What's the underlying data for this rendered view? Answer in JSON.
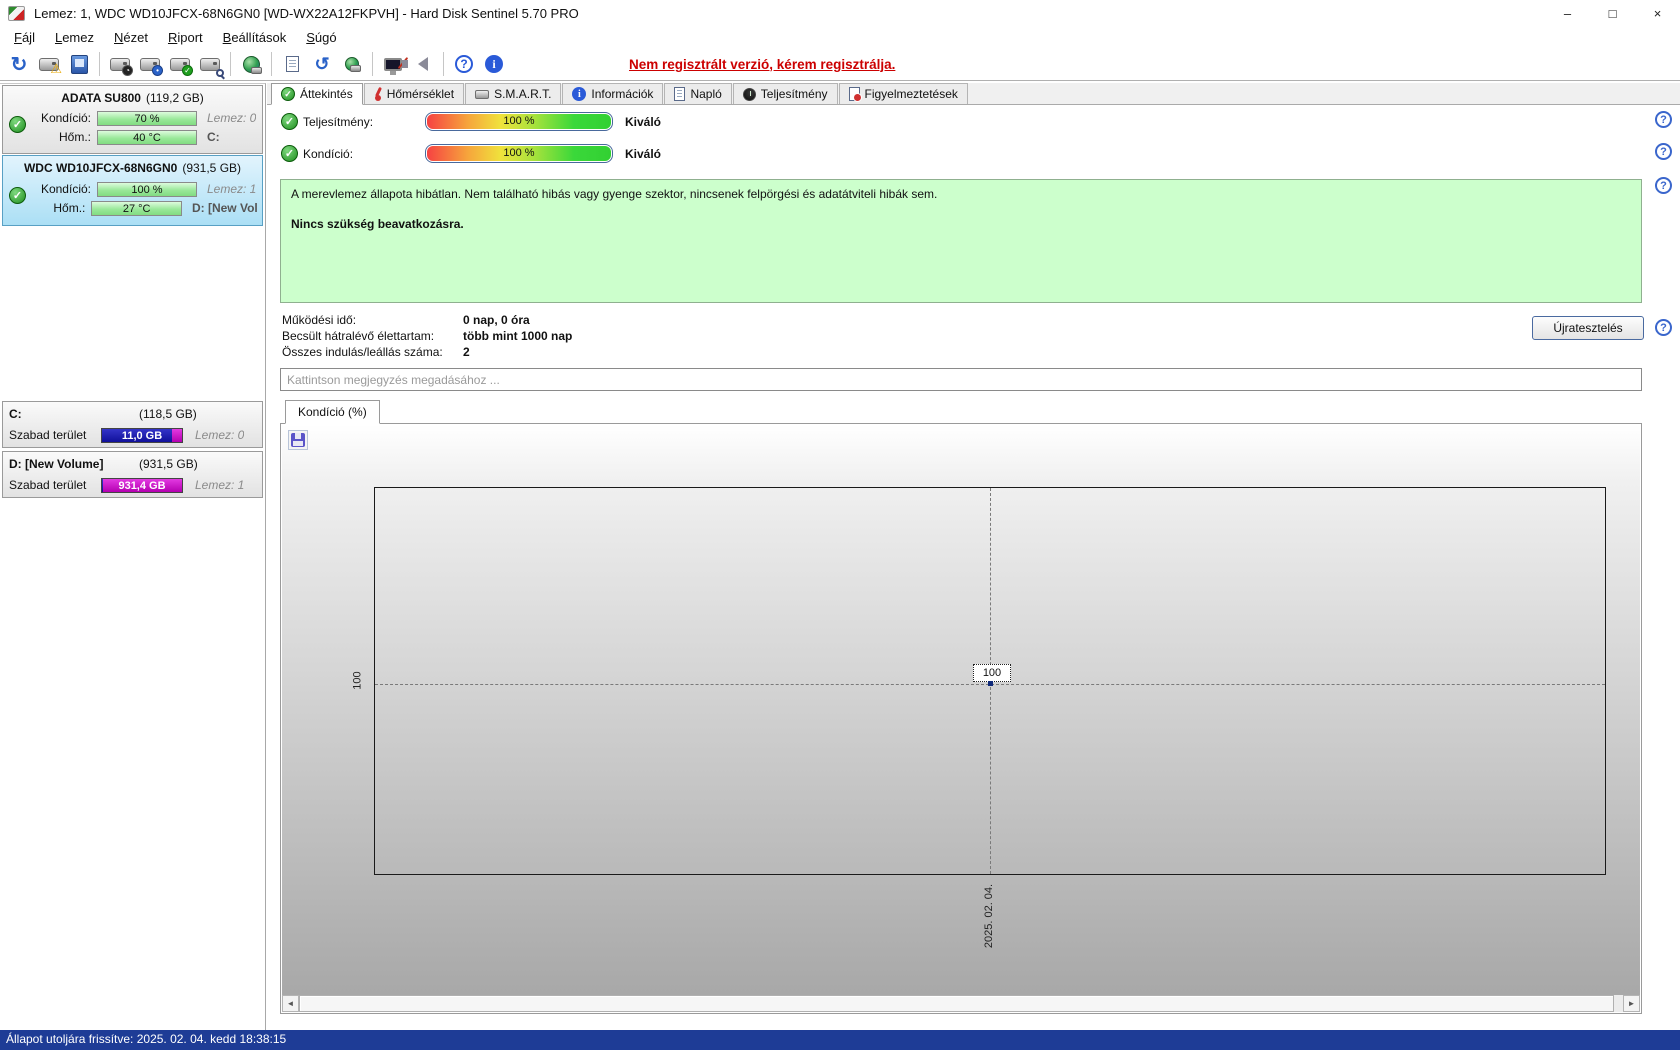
{
  "window": {
    "title": "Lemez: 1, WDC WD10JFCX-68N6GN0 [WD-WX22A12FKPVH]  -  Hard Disk Sentinel 5.70 PRO",
    "controls": {
      "minimize": "–",
      "maximize": "□",
      "close": "×"
    }
  },
  "menu": {
    "items": [
      {
        "accel": "F",
        "rest": "ájl"
      },
      {
        "accel": "L",
        "rest": "emez"
      },
      {
        "accel": "N",
        "rest": "ézet"
      },
      {
        "accel": "R",
        "rest": "iport"
      },
      {
        "accel": "B",
        "rest": "eállítások"
      },
      {
        "accel": "S",
        "rest": "úgó"
      }
    ]
  },
  "toolbar": {
    "register_notice": "Nem regisztrált verzió, kérem regisztrálja.",
    "icons": [
      "refresh-icon",
      "disk-warning-icon",
      "disk-monitor-icon",
      "disk-performance-icon",
      "disk-temperature-icon",
      "disk-health-icon",
      "disk-analyze-icon",
      "online-disk-icon",
      "report-clipboard-icon",
      "sync-icon",
      "web-report-icon",
      "desktop-settings-icon",
      "sound-icon",
      "help-icon",
      "info-icon"
    ]
  },
  "sidebar": {
    "disks": [
      {
        "name": "ADATA SU800",
        "size": "(119,2 GB)",
        "cond_label": "Kondíció:",
        "cond_value": "70 %",
        "temp_label": "Hőm.:",
        "temp_value": "40 °C",
        "disk_no": "Lemez: 0",
        "volume": "C:"
      },
      {
        "name": "WDC WD10JFCX-68N6GN0",
        "size": "(931,5 GB)",
        "cond_label": "Kondíció:",
        "cond_value": "100 %",
        "temp_label": "Hőm.:",
        "temp_value": "27 °C",
        "disk_no": "Lemez: 1",
        "volume": "D: [New Volu"
      }
    ],
    "partitions": [
      {
        "name": "C:",
        "size": "(118,5 GB)",
        "free_label": "Szabad terület",
        "free_value": "11,0 GB",
        "disk_no": "Lemez: 0",
        "free_pct": 12
      },
      {
        "name": "D: [New Volume]",
        "size": "(931,5 GB)",
        "free_label": "Szabad terület",
        "free_value": "931,4 GB",
        "disk_no": "Lemez: 1",
        "free_pct": 99
      }
    ]
  },
  "tabs": [
    {
      "label": "Áttekintés"
    },
    {
      "label": "Hőmérséklet"
    },
    {
      "label": "S.M.A.R.T."
    },
    {
      "label": "Információk"
    },
    {
      "label": "Napló"
    },
    {
      "label": "Teljesítmény"
    },
    {
      "label": "Figyelmeztetések"
    }
  ],
  "overview": {
    "perf_label": "Teljesítmény:",
    "perf_value": "100 %",
    "perf_rating": "Kiváló",
    "cond_label": "Kondíció:",
    "cond_value": "100 %",
    "cond_rating": "Kiváló",
    "status_text": "A merevlemez állapota hibátlan. Nem található hibás vagy gyenge szektor, nincsenek felpörgési és adatátviteli hibák sem.",
    "status_advice": "Nincs szükség beavatkozásra.",
    "stats": [
      {
        "label": "Működési idő:",
        "value": "0 nap, 0 óra"
      },
      {
        "label": "Becsült hátralévő élettartam:",
        "value": "több mint 1000 nap"
      },
      {
        "label": "Összes indulás/leállás száma:",
        "value": "2"
      }
    ],
    "retest_button": "Újratesztelés",
    "comment_placeholder": "Kattintson megjegyzés megadásához ..."
  },
  "chart": {
    "tab_label": "Kondíció  (%)",
    "ytick": "100",
    "point_label": "100",
    "xtick": "2025. 02. 04.",
    "chart_data": {
      "type": "line",
      "x": [
        "2025. 02. 04."
      ],
      "series": [
        {
          "name": "Kondíció (%)",
          "values": [
            100
          ]
        }
      ],
      "ylabel": "Kondíció (%)",
      "ylim": [
        0,
        100
      ],
      "point_labels": [
        "100"
      ]
    }
  },
  "statusbar": {
    "text": "Állapot utoljára frissítve: 2025. 02. 04. kedd 18:38:15"
  }
}
